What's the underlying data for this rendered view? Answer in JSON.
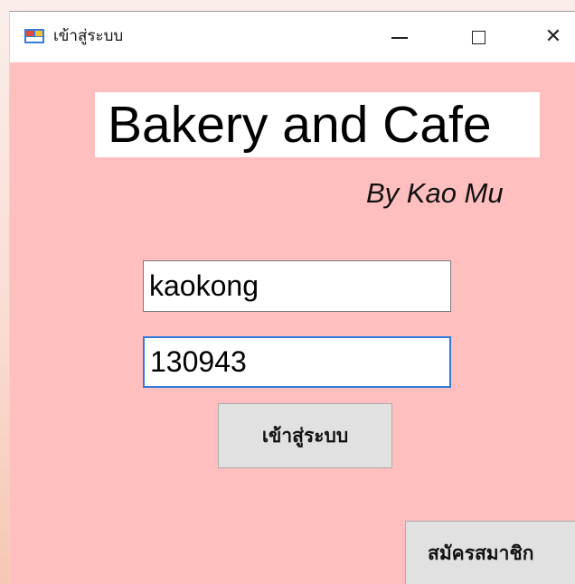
{
  "window": {
    "title": "เข้าสู่ระบบ",
    "controls": {
      "minimize": "—",
      "maximize": "□",
      "close": "✕"
    },
    "icon": "app-window-icon"
  },
  "header": {
    "title": "Bakery and Cafe",
    "byline": "By Kao Mu"
  },
  "form": {
    "username_value": "kaokong",
    "password_value": "130943",
    "login_label": "เข้าสู่ระบบ",
    "register_label": "สมัครสมาชิก"
  },
  "colors": {
    "form_background": "#ffbfbf",
    "title_bar": "#ffffff",
    "button_face": "#e1e1e1",
    "focus_border": "#2f7ad9"
  }
}
